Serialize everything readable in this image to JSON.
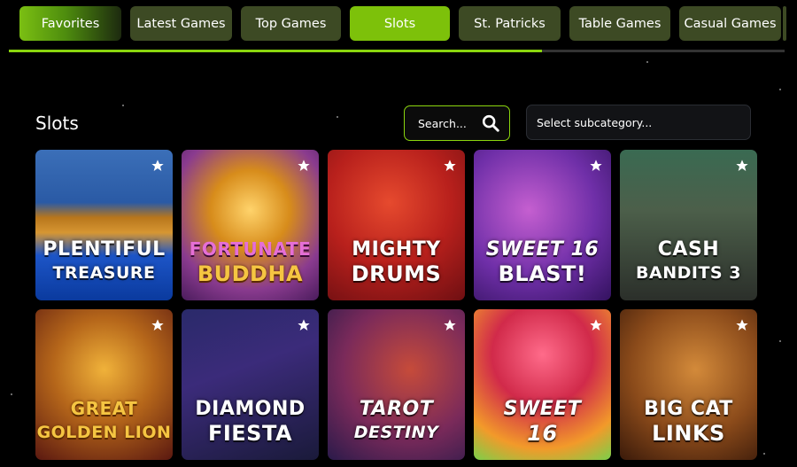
{
  "tabs": [
    {
      "label": "Favorites"
    },
    {
      "label": "Latest Games"
    },
    {
      "label": "Top Games"
    },
    {
      "label": "Slots"
    },
    {
      "label": "St. Patricks"
    },
    {
      "label": "Table Games"
    },
    {
      "label": "Casual Games"
    }
  ],
  "active_tab": "Slots",
  "section": {
    "title": "Slots"
  },
  "search": {
    "placeholder": "Search..."
  },
  "subcategory": {
    "placeholder": "Select subcategory..."
  },
  "games": [
    {
      "line1": "PLENTIFUL",
      "line2": "TREASURE"
    },
    {
      "line1": "FORTUNATE",
      "line2": "BUDDHA"
    },
    {
      "line1": "MIGHTY",
      "line2": "DRUMS"
    },
    {
      "line1": "SWEET 16",
      "line2": "BLAST!"
    },
    {
      "line1": "CASH",
      "line2": "BANDITS 3"
    },
    {
      "line1": "GREAT",
      "line2": "GOLDEN LION"
    },
    {
      "line1": "DIAMOND",
      "line2": "FIESTA"
    },
    {
      "line1": "TAROT",
      "line2": "DESTINY"
    },
    {
      "line1": "SWEET",
      "line2": "16"
    },
    {
      "line1": "BIG CAT",
      "line2": "LINKS"
    }
  ],
  "colors": {
    "accent": "#7dc10a",
    "tab_bg": "#3d4a24",
    "page_bg": "#000000"
  },
  "icons": {
    "search": "search-icon",
    "favorite": "star-icon"
  }
}
